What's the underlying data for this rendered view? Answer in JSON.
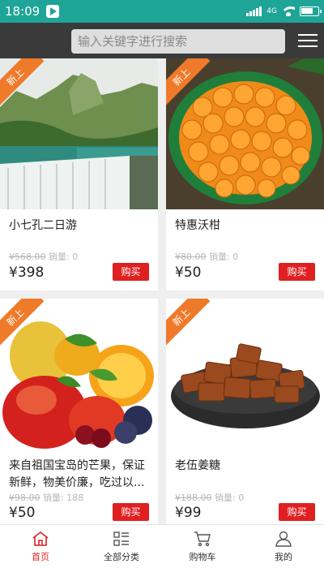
{
  "status_bar": {
    "time": "18:09",
    "network": "4G"
  },
  "search": {
    "placeholder": "输入关键字进行搜索"
  },
  "products": [
    {
      "badge": "新上",
      "title": "小七孔二日游",
      "old_price": "¥568.00",
      "sales": "销量: 0",
      "price": "¥398",
      "buy_label": "购买"
    },
    {
      "badge": "新上",
      "title": "特惠沃柑",
      "old_price": "¥80.00",
      "sales": "销量: 0",
      "price": "¥50",
      "buy_label": "购买"
    },
    {
      "badge": "新上",
      "title": "来自祖国宝岛的芒果，保证新鲜，物美价廉，吃过以...",
      "old_price": "¥98.00",
      "sales": "销量: 188",
      "price": "¥50",
      "buy_label": "购买"
    },
    {
      "badge": "新上",
      "title": "老伍姜糖",
      "old_price": "¥188.00",
      "sales": "销量: 0",
      "price": "¥99",
      "buy_label": "购买"
    }
  ],
  "tabs": [
    {
      "label": "首页",
      "icon": "home-icon",
      "active": true
    },
    {
      "label": "全部分类",
      "icon": "category-icon",
      "active": false
    },
    {
      "label": "购物车",
      "icon": "cart-icon",
      "active": false
    },
    {
      "label": "我的",
      "icon": "user-icon",
      "active": false
    }
  ],
  "colors": {
    "status_bar": "#1ea598",
    "header": "#3a3a3a",
    "accent": "#e02020",
    "ribbon": "#ef7a2a"
  }
}
